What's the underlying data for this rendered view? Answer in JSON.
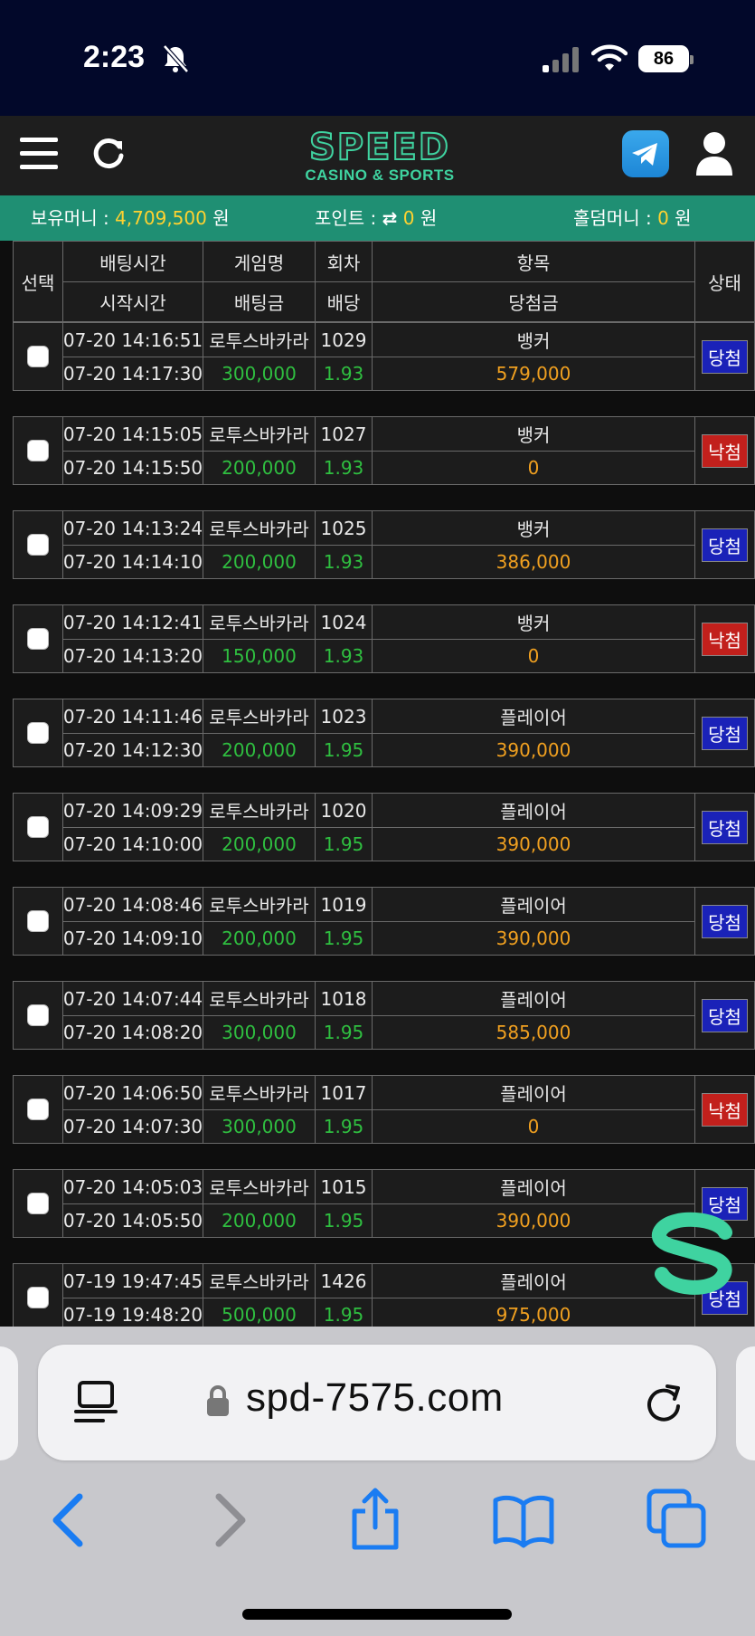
{
  "status": {
    "time": "2:23",
    "battery": "86"
  },
  "header": {
    "logo_main": "SPEED",
    "logo_sub": "CASINO & SPORTS"
  },
  "money": {
    "held_label": "보유머니 : ",
    "held_value": "4,709,500",
    "held_unit": " 원",
    "point_label": "포인트 : ",
    "point_swap": "⇄",
    "point_value": "0",
    "point_unit": " 원",
    "holdem_label": "홀덤머니 : ",
    "holdem_value": "0",
    "holdem_unit": " 원"
  },
  "table": {
    "headers": {
      "select": "선택",
      "bet_time": "배팅시간",
      "start_time": "시작시간",
      "game": "게임명",
      "bet_amount": "배팅금",
      "round": "회차",
      "odds": "배당",
      "item": "항목",
      "win_amount": "당첨금",
      "status": "상태"
    },
    "rows": [
      {
        "bet_time": "07-20 14:16:51",
        "start_time": "07-20 14:17:30",
        "game": "로투스바카라",
        "amount": "300,000",
        "round": "1029",
        "odds": "1.93",
        "item": "뱅커",
        "win": "579,000",
        "status": "당첨",
        "result": "win"
      },
      {
        "bet_time": "07-20 14:15:05",
        "start_time": "07-20 14:15:50",
        "game": "로투스바카라",
        "amount": "200,000",
        "round": "1027",
        "odds": "1.93",
        "item": "뱅커",
        "win": "0",
        "status": "낙첨",
        "result": "lose"
      },
      {
        "bet_time": "07-20 14:13:24",
        "start_time": "07-20 14:14:10",
        "game": "로투스바카라",
        "amount": "200,000",
        "round": "1025",
        "odds": "1.93",
        "item": "뱅커",
        "win": "386,000",
        "status": "당첨",
        "result": "win"
      },
      {
        "bet_time": "07-20 14:12:41",
        "start_time": "07-20 14:13:20",
        "game": "로투스바카라",
        "amount": "150,000",
        "round": "1024",
        "odds": "1.93",
        "item": "뱅커",
        "win": "0",
        "status": "낙첨",
        "result": "lose"
      },
      {
        "bet_time": "07-20 14:11:46",
        "start_time": "07-20 14:12:30",
        "game": "로투스바카라",
        "amount": "200,000",
        "round": "1023",
        "odds": "1.95",
        "item": "플레이어",
        "win": "390,000",
        "status": "당첨",
        "result": "win"
      },
      {
        "bet_time": "07-20 14:09:29",
        "start_time": "07-20 14:10:00",
        "game": "로투스바카라",
        "amount": "200,000",
        "round": "1020",
        "odds": "1.95",
        "item": "플레이어",
        "win": "390,000",
        "status": "당첨",
        "result": "win"
      },
      {
        "bet_time": "07-20 14:08:46",
        "start_time": "07-20 14:09:10",
        "game": "로투스바카라",
        "amount": "200,000",
        "round": "1019",
        "odds": "1.95",
        "item": "플레이어",
        "win": "390,000",
        "status": "당첨",
        "result": "win"
      },
      {
        "bet_time": "07-20 14:07:44",
        "start_time": "07-20 14:08:20",
        "game": "로투스바카라",
        "amount": "300,000",
        "round": "1018",
        "odds": "1.95",
        "item": "플레이어",
        "win": "585,000",
        "status": "당첨",
        "result": "win"
      },
      {
        "bet_time": "07-20 14:06:50",
        "start_time": "07-20 14:07:30",
        "game": "로투스바카라",
        "amount": "300,000",
        "round": "1017",
        "odds": "1.95",
        "item": "플레이어",
        "win": "0",
        "status": "낙첨",
        "result": "lose"
      },
      {
        "bet_time": "07-20 14:05:03",
        "start_time": "07-20 14:05:50",
        "game": "로투스바카라",
        "amount": "200,000",
        "round": "1015",
        "odds": "1.95",
        "item": "플레이어",
        "win": "390,000",
        "status": "당첨",
        "result": "win"
      },
      {
        "bet_time": "07-19 19:47:45",
        "start_time": "07-19 19:48:20",
        "game": "로투스바카라",
        "amount": "500,000",
        "round": "1426",
        "odds": "1.95",
        "item": "플레이어",
        "win": "975,000",
        "status": "당첨",
        "result": "win"
      }
    ]
  },
  "browser": {
    "url": "spd-7575.com"
  },
  "colors": {
    "accent": "#1f8f73",
    "win": "#1a22b8",
    "lose": "#c2201c",
    "amount": "#2fbf40",
    "payout": "#f0a020"
  }
}
